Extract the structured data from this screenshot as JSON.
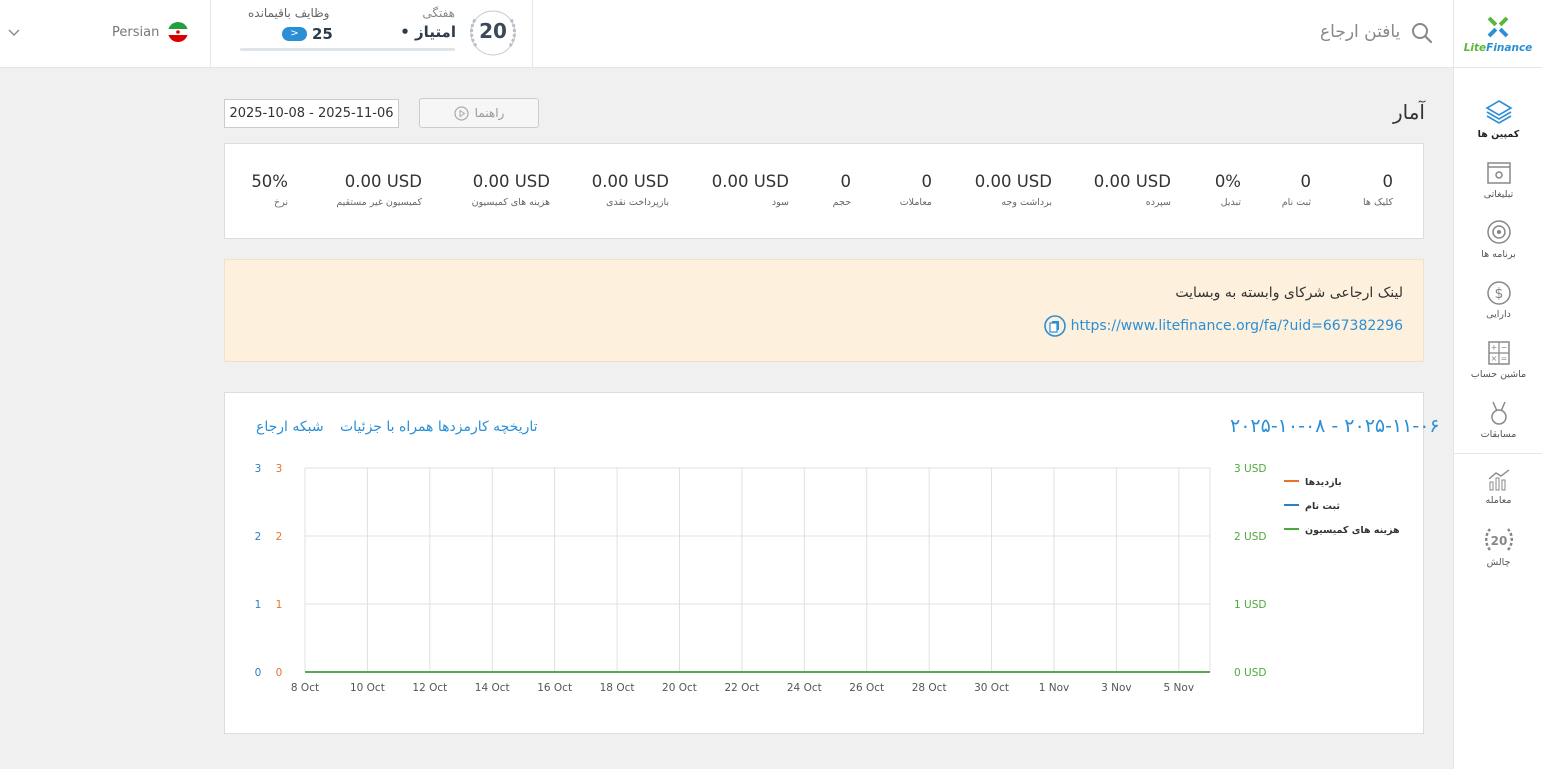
{
  "header": {
    "brand": "LiteFinance",
    "search_placeholder": "یافتن ارجاع",
    "challenge": {
      "badge_number": "20",
      "weekly_label": "هفتگی",
      "points_label": "• امتیاز",
      "tasks_label": "وظایف باقیمانده",
      "tasks_remaining": "25",
      "tasks_button": ">"
    },
    "language": {
      "label": "Persian",
      "flag": "iran-flag"
    }
  },
  "sidebar": {
    "items": [
      {
        "label": "کمپین ها",
        "icon": "layers-icon",
        "active": true
      },
      {
        "label": "تبلیغاتی",
        "icon": "promo-window-icon",
        "active": false
      },
      {
        "label": "برنامه ها",
        "icon": "target-icon",
        "active": false
      },
      {
        "label": "دارایی",
        "icon": "dollar-icon",
        "active": false
      },
      {
        "label": "ماشین حساب",
        "icon": "calculator-icon",
        "active": false
      },
      {
        "label": "مسابقات",
        "icon": "medal-icon",
        "active": false
      },
      {
        "label": "معامله",
        "icon": "trade-chart-icon",
        "active": false
      },
      {
        "label": "چالش",
        "icon": "challenge-laurel-icon",
        "active": false
      }
    ]
  },
  "main": {
    "title": "آمار",
    "guide_button": "راهنما",
    "date_range": "2025-10-08 - 2025-11-06",
    "stats": [
      {
        "value": "0",
        "label": "کلیک ها"
      },
      {
        "value": "0",
        "label": "ثبت نام"
      },
      {
        "value": "0%",
        "label": "تبدیل"
      },
      {
        "value": "0.00 USD",
        "label": "سپرده"
      },
      {
        "value": "0.00 USD",
        "label": "برداشت وجه"
      },
      {
        "value": "0",
        "label": "معاملات"
      },
      {
        "value": "0",
        "label": "حجم"
      },
      {
        "value": "0.00 USD",
        "label": "سود"
      },
      {
        "value": "0.00 USD",
        "label": "بازپرداخت نقدی"
      },
      {
        "value": "0.00 USD",
        "label": "هزینه های کمیسیون"
      },
      {
        "value": "0.00 USD",
        "label": "کمیسیون غیر مستقیم"
      },
      {
        "value": "50%",
        "label": "نرخ"
      }
    ],
    "referral": {
      "title": "لینک ارجاعی شرکای وابسته به وبسایت",
      "url": "https://www.litefinance.org/fa/?uid=667382296"
    },
    "chart_header": {
      "date": "۲۰۲۵-۱۰-۰۸ - ۲۰۲۵-۱۱-۰۶",
      "history_link": "تاریخچه کارمزدها همراه با جزئیات",
      "network_link": "شبکه ارجاع"
    }
  },
  "chart_data": {
    "type": "line",
    "x": [
      "8 Oct",
      "10 Oct",
      "12 Oct",
      "14 Oct",
      "16 Oct",
      "18 Oct",
      "20 Oct",
      "22 Oct",
      "24 Oct",
      "26 Oct",
      "28 Oct",
      "30 Oct",
      "1 Nov",
      "3 Nov",
      "5 Nov"
    ],
    "y_left_blue_ticks": [
      "0",
      "1",
      "2",
      "3"
    ],
    "y_left_orange_ticks": [
      "0",
      "1",
      "2",
      "3"
    ],
    "y_right_ticks": [
      "0 USD",
      "1 USD",
      "2 USD",
      "3 USD"
    ],
    "ylim": [
      0,
      3
    ],
    "grid": true,
    "legend_position": "right",
    "series": [
      {
        "name": "بازدیدها",
        "color": "#e8722c",
        "values": [
          0,
          0,
          0,
          0,
          0,
          0,
          0,
          0,
          0,
          0,
          0,
          0,
          0,
          0,
          0
        ]
      },
      {
        "name": "ثبت نام",
        "color": "#2b7fc4",
        "values": [
          0,
          0,
          0,
          0,
          0,
          0,
          0,
          0,
          0,
          0,
          0,
          0,
          0,
          0,
          0
        ]
      },
      {
        "name": "هزینه های کمیسیون",
        "color": "#4caa3c",
        "values": [
          0,
          0,
          0,
          0,
          0,
          0,
          0,
          0,
          0,
          0,
          0,
          0,
          0,
          0,
          0
        ]
      }
    ],
    "colors": {
      "blue_axis": "#2b7fc4",
      "orange_axis": "#e8722c",
      "green_axis": "#4caa3c"
    }
  }
}
